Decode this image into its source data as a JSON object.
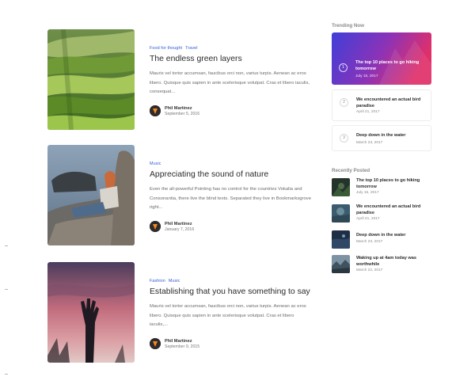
{
  "posts": [
    {
      "categories": [
        "Food for thought",
        "Travel"
      ],
      "title": "The endless green layers",
      "excerpt": "Mauris vel tortor accumsan, faucibus orci non, varius turpis. Aenean ac eros libero. Quisque quis sapien in ante scelerisque volutpat. Cras et libero iaculis, consequat...",
      "author": "Phil Martinez",
      "date": "September 5, 2016",
      "image": "green-hills"
    },
    {
      "categories": [
        "Music"
      ],
      "title": "Appreciating the sound of nature",
      "excerpt": "Even the all-powerful Pointing has no control for the countries Vokalia and Consonantia, there live the blind texts. Separated they live in Bookmarksgrove right...",
      "author": "Phil Martinez",
      "date": "January 7, 2016",
      "image": "woman-on-rocks"
    },
    {
      "categories": [
        "Fashion",
        "Music"
      ],
      "title": "Establishing that you have something to say",
      "excerpt": "Mauris vel tortor accumsan, faucibus orci non, varius turpis. Aenean ac eros libero. Quisque quis sapien in ante scelerisque volutpat. Cras et libero iaculis,...",
      "author": "Phil Martinez",
      "date": "September 9, 2015",
      "image": "hand-sunset"
    }
  ],
  "sidebar": {
    "trending_heading": "Trending Now",
    "trending": [
      {
        "num": "1",
        "title": "The top 10 places to go hiking tomorrow",
        "date": "July 15, 2017"
      },
      {
        "num": "2",
        "title": "We encountered an actual bird paradise",
        "date": "April 21, 2017"
      },
      {
        "num": "3",
        "title": "Deep down in the water",
        "date": "March 23, 2017"
      }
    ],
    "recent_heading": "Recently Posted",
    "recent": [
      {
        "title": "The top 10 places to go hiking tomorrow",
        "date": "July 15, 2017"
      },
      {
        "title": "We encountered an actual bird paradise",
        "date": "April 21, 2017"
      },
      {
        "title": "Deep down in the water",
        "date": "March 23, 2017"
      },
      {
        "title": "Waking up at 4am today was worthwhile",
        "date": "March 22, 2017"
      }
    ]
  },
  "colors": {
    "category_link": "#2f5bd6",
    "featured_gradient_start": "#3f3fd8",
    "featured_gradient_end": "#e0306a"
  }
}
